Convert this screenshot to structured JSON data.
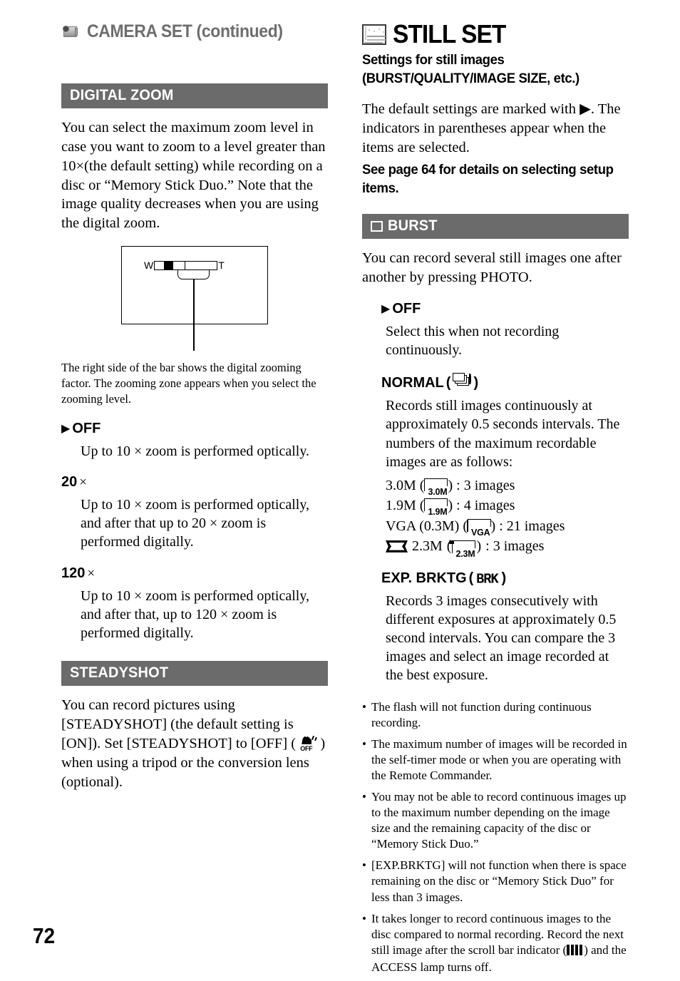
{
  "page": {
    "number": "72"
  },
  "left": {
    "chapter_header": {
      "icon": "camcorder-icon",
      "title": "CAMERA SET (continued)"
    },
    "digital_zoom": {
      "bar_title": "DIGITAL ZOOM",
      "intro": "You can select the maximum zoom level in case you want to zoom to a level greater than 10×(the default setting) while recording on a disc or “Memory Stick Duo.” Note that the image quality decreases when you are using the digital zoom.",
      "figure": {
        "w_label": "W",
        "t_label": "T"
      },
      "figure_caption": "The right side of the bar shows the digital zooming factor. The zooming zone appears when you select the zooming level.",
      "options": [
        {
          "marker": "▶",
          "label": "OFF",
          "suffix": "",
          "body": "Up to 10 × zoom is performed optically."
        },
        {
          "marker": "",
          "label": "20",
          "suffix": "×",
          "body": "Up to 10 × zoom is performed optically, and after that up to 20 × zoom is performed digitally."
        },
        {
          "marker": "",
          "label": "120",
          "suffix": "×",
          "body": "Up to 10 × zoom is performed optically, and after that, up to 120 × zoom is performed digitally."
        }
      ]
    },
    "steadyshot": {
      "bar_title": "STEADYSHOT",
      "body_part1": "You can record pictures using [STEADYSHOT] (the default setting is [ON]). Set [STEADYSHOT] to [OFF] ( ",
      "icon_label": "OFF",
      "body_part2": " ) when using a tripod or the conversion lens (optional)."
    }
  },
  "right": {
    "still_set": {
      "icon": "still-image-icon",
      "title": "STILL SET",
      "subtitle_line1": "Settings for still images",
      "subtitle_line2": "(BURST/QUALITY/IMAGE SIZE, etc.)",
      "intro": "The default settings are marked with ▶. The indicators in parentheses appear when the items are selected.",
      "see_page": "See page 64 for details on selecting setup items."
    },
    "burst": {
      "bar_icon": "white-square-icon",
      "bar_title": "BURST",
      "intro": "You can record several still images one after another by pressing PHOTO.",
      "options": [
        {
          "marker": "▶",
          "label": "OFF",
          "body": "Select this when not recording continuously."
        },
        {
          "marker": "",
          "label": "NORMAL",
          "icon": "burst-frames-icon",
          "body": "Records still images continuously at approximately 0.5 seconds intervals. The numbers of the maximum recordable images are as follows:"
        }
      ],
      "size_list": [
        {
          "name": "3.0M",
          "icon_label": "3.0M",
          "wide": false,
          "result": ": 3 images"
        },
        {
          "name": "1.9M",
          "icon_label": "1.9M",
          "wide": false,
          "result": ": 4 images"
        },
        {
          "name": "VGA (0.3M)",
          "icon_label": "VGA",
          "wide": false,
          "result": ": 21 images"
        },
        {
          "name": "2.3M",
          "icon_label": "2.3M",
          "wide": true,
          "result": ": 3 images"
        }
      ],
      "exp_brktg": {
        "label": "EXP. BRKTG",
        "icon_text": "BRK",
        "body": "Records 3 images consecutively with different exposures at approximately 0.5 second intervals. You can compare the 3 images and select an image recorded at the best exposure."
      },
      "notes": [
        "The flash will not function during continuous recording.",
        "The maximum number of images will be recorded in the self-timer mode or when you are operating with the Remote Commander.",
        "You may not be able to record continuous images up to the maximum number depending on the image size and the remaining capacity of the disc or “Memory Stick Duo.”",
        "[EXP.BRKTG] will not function when there is space remaining on the disc or “Memory Stick Duo” for less than 3 images."
      ],
      "note_last_part1": "It takes longer to record continuous images to the disc compared to normal recording. Record the next still image after the scroll bar indicator (",
      "note_last_part2": ") and the ACCESS lamp turns off."
    }
  },
  "colors": {
    "section_bar_bg": "#6b6b6b",
    "chapter_title": "#6e6e6e",
    "text": "#000000"
  }
}
